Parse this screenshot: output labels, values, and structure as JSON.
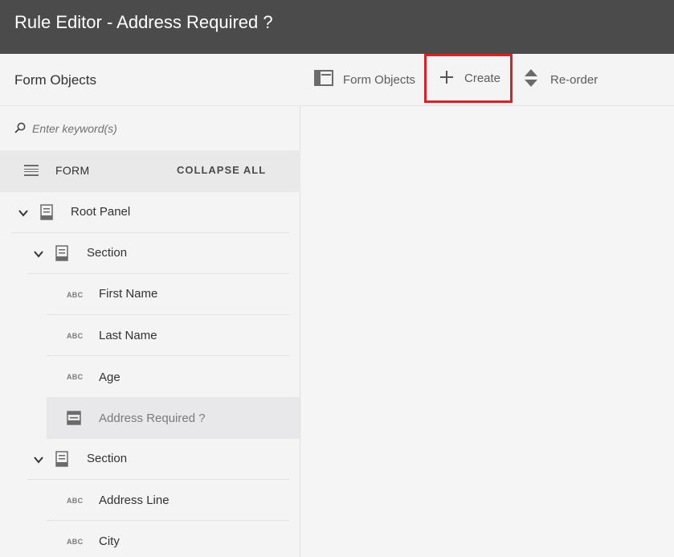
{
  "window": {
    "title": "Rule Editor - Address Required ?"
  },
  "toolbar": {
    "left_title": "Form Objects",
    "form_objects_label": "Form Objects",
    "create_label": "Create",
    "reorder_label": "Re-order",
    "highlight_color": "#d7222a"
  },
  "sidebar": {
    "search_placeholder": "Enter keyword(s)",
    "form_label": "FORM",
    "collapse_all_label": "COLLAPSE ALL",
    "tree": {
      "root_panel": "Root Panel",
      "section1": "Section",
      "first_name": "First Name",
      "last_name": "Last Name",
      "age": "Age",
      "address_required": "Address Required ?",
      "section2": "Section",
      "address_line": "Address Line",
      "city": "City",
      "text_field_icon": "ABC"
    }
  },
  "colors": {
    "titlebar": "#4b4b4b",
    "background": "#f4f4f4",
    "selected_row": "#e8e8ea"
  }
}
